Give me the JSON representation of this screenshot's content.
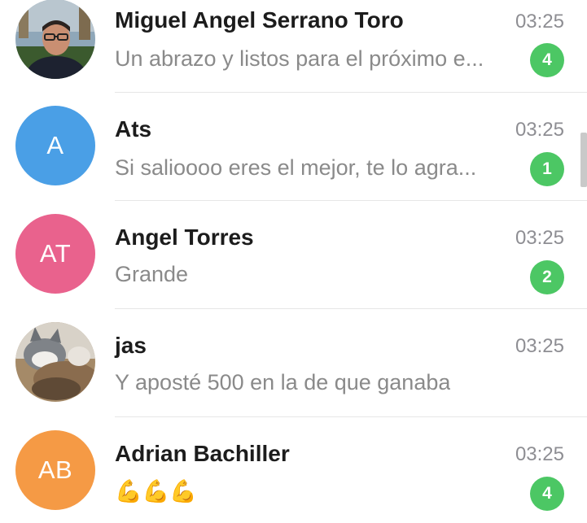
{
  "chats": [
    {
      "name": "Miguel Angel Serrano Toro",
      "time": "03:25",
      "preview": "Un abrazo y listos para el próximo e...",
      "unread": "4",
      "avatar_type": "photo",
      "avatar_desc": "man-with-glasses-photo"
    },
    {
      "name": "Ats",
      "time": "03:25",
      "preview": "Si salioooo eres el mejor, te lo agra...",
      "unread": "1",
      "avatar_type": "initials",
      "initials": "A",
      "avatar_color": "#4a9fe6"
    },
    {
      "name": "Angel Torres",
      "time": "03:25",
      "preview": "Grande",
      "unread": "2",
      "avatar_type": "initials",
      "initials": "AT",
      "avatar_color": "#e9628d"
    },
    {
      "name": "jas",
      "time": "03:25",
      "preview": "Y aposté 500 en la de que ganaba",
      "unread": "",
      "avatar_type": "photo",
      "avatar_desc": "cat-photo"
    },
    {
      "name": "Adrian Bachiller",
      "time": "03:25",
      "preview": "💪💪💪",
      "unread": "4",
      "avatar_type": "initials",
      "initials": "AB",
      "avatar_color": "#f59a45"
    }
  ],
  "colors": {
    "unread_badge": "#4cc764",
    "name_text": "#1c1c1c",
    "secondary_text": "#8a8a8a"
  }
}
